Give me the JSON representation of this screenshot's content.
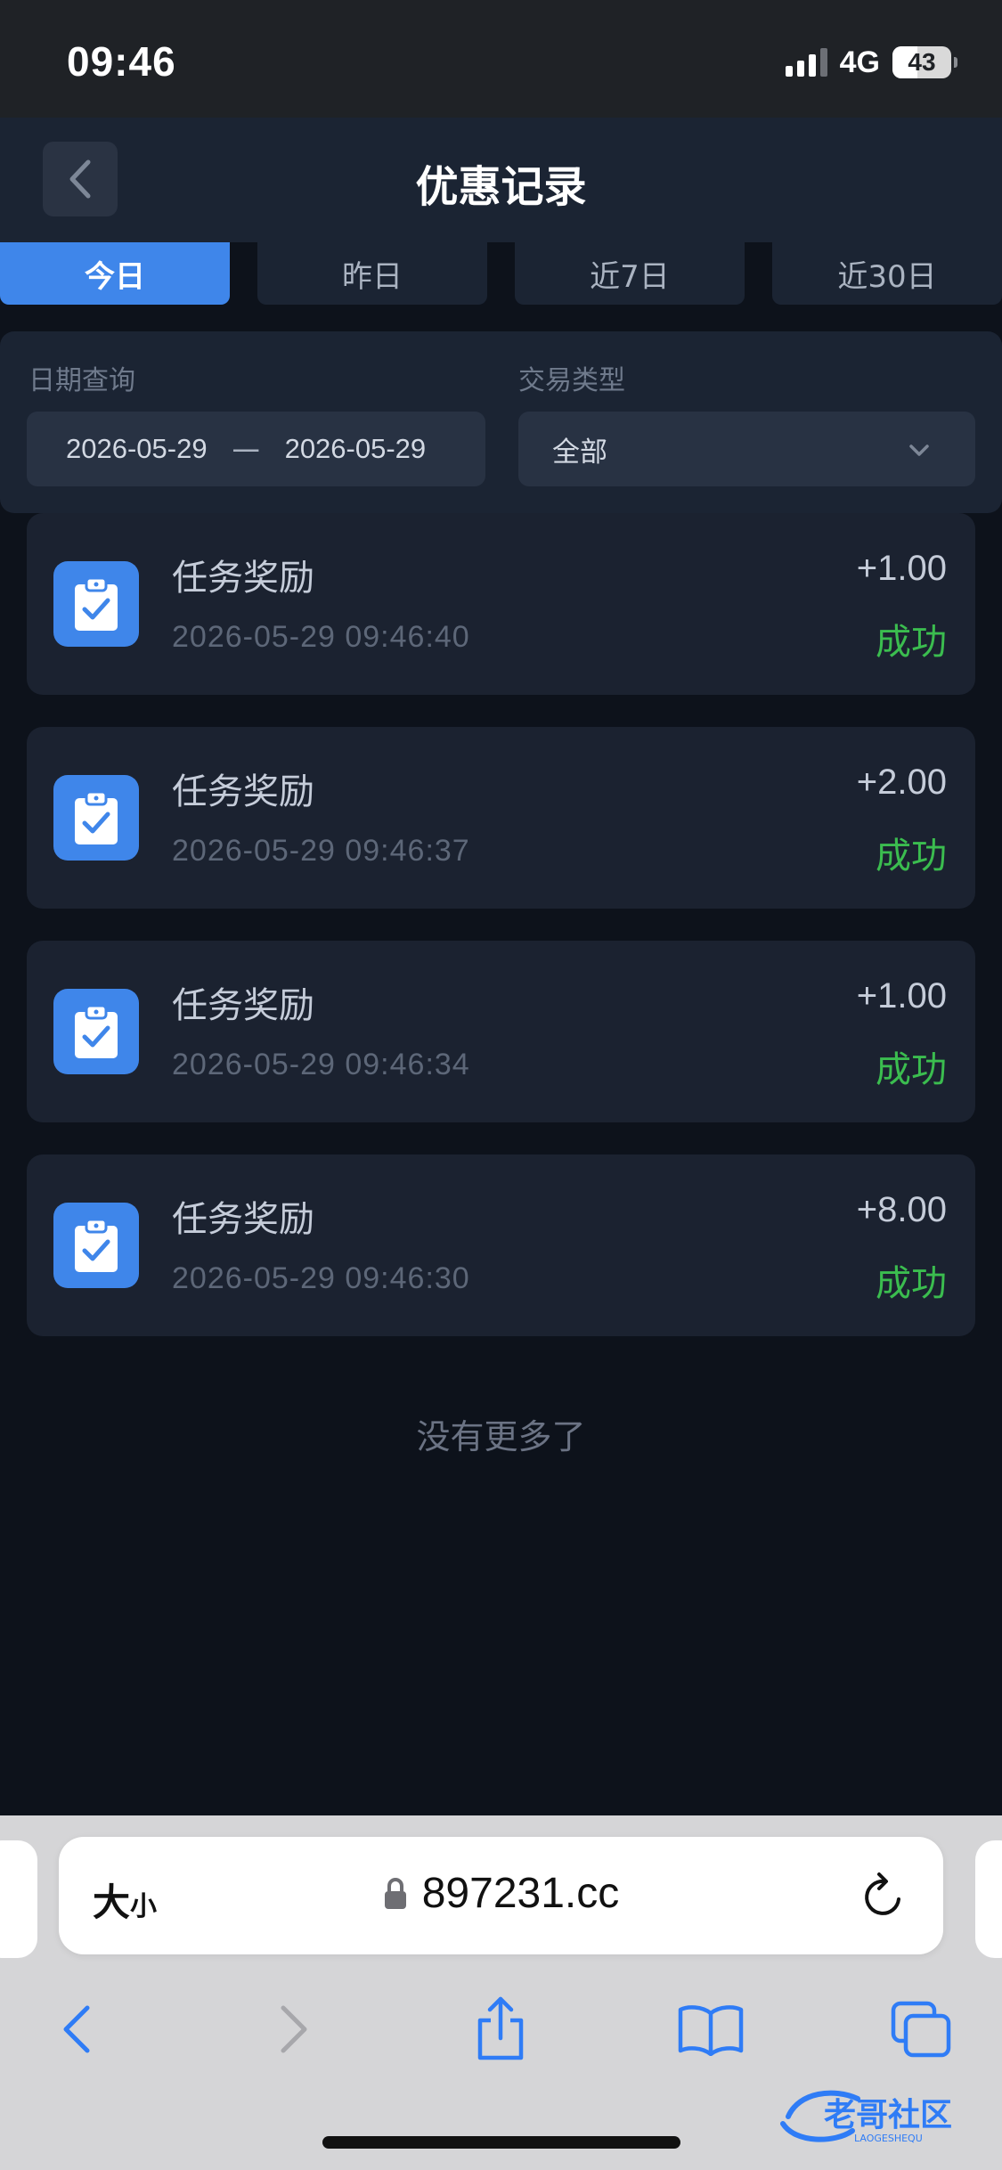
{
  "status_bar": {
    "time": "09:46",
    "network": "4G",
    "battery": "43",
    "battery_level_percent": 43
  },
  "header": {
    "title": "优惠记录",
    "back_icon": "chevron-left-icon"
  },
  "tabs": [
    {
      "label": "今日",
      "active": true
    },
    {
      "label": "昨日",
      "active": false
    },
    {
      "label": "近7日",
      "active": false
    },
    {
      "label": "近30日",
      "active": false
    }
  ],
  "filters": {
    "date_label": "日期查询",
    "date_start": "2026-05-29",
    "date_separator": "一",
    "date_end": "2026-05-29",
    "type_label": "交易类型",
    "type_value": "全部"
  },
  "records": [
    {
      "title": "任务奖励",
      "time": "2026-05-29 09:46:40",
      "amount": "+1.00",
      "status": "成功"
    },
    {
      "title": "任务奖励",
      "time": "2026-05-29 09:46:37",
      "amount": "+2.00",
      "status": "成功"
    },
    {
      "title": "任务奖励",
      "time": "2026-05-29 09:46:34",
      "amount": "+1.00",
      "status": "成功"
    },
    {
      "title": "任务奖励",
      "time": "2026-05-29 09:46:30",
      "amount": "+8.00",
      "status": "成功"
    }
  ],
  "no_more": "没有更多了",
  "browser": {
    "text_size_big": "大",
    "text_size_small": "小",
    "url": "897231.cc",
    "icons": [
      "lock-icon",
      "reload-icon",
      "back-icon",
      "forward-icon",
      "share-icon",
      "bookmarks-icon",
      "tabs-icon"
    ]
  },
  "colors": {
    "accent": "#3f86ea",
    "success": "#3bbd4f",
    "background": "#0d121b",
    "card": "#1b2230"
  }
}
